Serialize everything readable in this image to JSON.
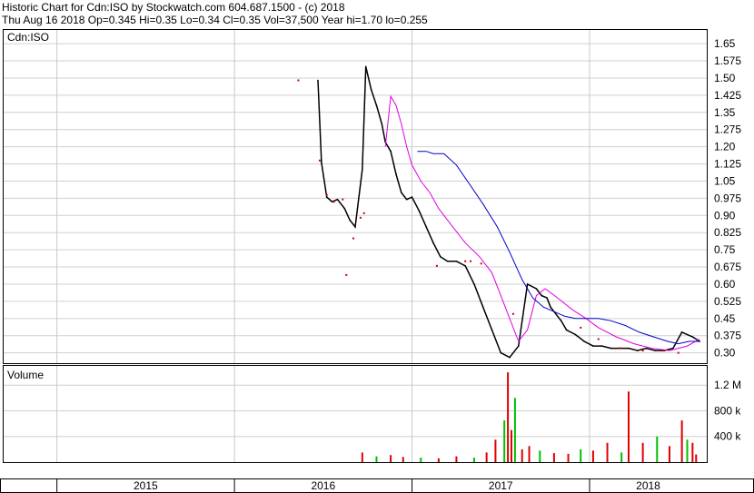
{
  "header": {
    "title": "Historic Chart for Cdn:ISO by Stockwatch.com 604.687.1500 - (c) 2018",
    "quote": "Thu Aug 16 2018   Op=0.345   Hi=0.35   Lo=0.34   Cl=0.35   Vol=37,500   Year hi=1.70   lo=0.255"
  },
  "chart_data": [
    {
      "type": "line",
      "panel_label": "Cdn:ISO",
      "y_ticks": [
        "0.30",
        "0.375",
        "0.45",
        "0.525",
        "0.60",
        "0.675",
        "0.75",
        "0.825",
        "0.90",
        "0.975",
        "1.05",
        "1.125",
        "1.20",
        "1.275",
        "1.35",
        "1.425",
        "1.50",
        "1.575",
        "1.65"
      ],
      "ylim": [
        0.255,
        1.71
      ],
      "grid": true,
      "x_axis_years": [
        "2015",
        "2016",
        "2017",
        "2018"
      ],
      "price_series": {
        "name": "",
        "color": "#000000",
        "x_year": [
          2016.47,
          2016.49,
          2016.52,
          2016.55,
          2016.58,
          2016.62,
          2016.65,
          2016.68,
          2016.72,
          2016.74,
          2016.77,
          2016.8,
          2016.83,
          2016.85,
          2016.88,
          2016.91,
          2016.94,
          2016.97,
          2017.0,
          2017.04,
          2017.08,
          2017.12,
          2017.16,
          2017.2,
          2017.25,
          2017.3,
          2017.35,
          2017.4,
          2017.45,
          2017.5,
          2017.55,
          2017.6,
          2017.65,
          2017.7,
          2017.73,
          2017.76,
          2017.78,
          2017.81,
          2017.84,
          2017.87,
          2017.92,
          2017.97,
          2018.02,
          2018.07,
          2018.12,
          2018.17,
          2018.22,
          2018.27,
          2018.32,
          2018.37,
          2018.42,
          2018.47,
          2018.52,
          2018.55,
          2018.58,
          2018.62
        ],
        "close": [
          1.49,
          1.13,
          0.98,
          0.96,
          0.97,
          0.93,
          0.88,
          0.85,
          1.1,
          1.55,
          1.45,
          1.38,
          1.3,
          1.22,
          1.18,
          1.08,
          1.0,
          0.97,
          0.98,
          0.92,
          0.85,
          0.78,
          0.72,
          0.7,
          0.7,
          0.68,
          0.6,
          0.5,
          0.4,
          0.3,
          0.28,
          0.33,
          0.6,
          0.58,
          0.55,
          0.54,
          0.5,
          0.47,
          0.44,
          0.4,
          0.38,
          0.35,
          0.33,
          0.33,
          0.32,
          0.32,
          0.32,
          0.31,
          0.32,
          0.31,
          0.31,
          0.32,
          0.39,
          0.38,
          0.37,
          0.35
        ]
      },
      "ma_fast": {
        "name": "",
        "color": "#e000e0",
        "x_year": [
          2016.85,
          2016.88,
          2016.91,
          2016.94,
          2016.97,
          2017.0,
          2017.05,
          2017.1,
          2017.15,
          2017.22,
          2017.3,
          2017.38,
          2017.45,
          2017.5,
          2017.56,
          2017.6,
          2017.65,
          2017.7,
          2017.75,
          2017.82,
          2017.9,
          2017.98,
          2018.05,
          2018.15,
          2018.25,
          2018.35,
          2018.45,
          2018.55,
          2018.62
        ],
        "values": [
          1.2,
          1.42,
          1.38,
          1.3,
          1.2,
          1.12,
          1.05,
          1.0,
          0.93,
          0.86,
          0.78,
          0.72,
          0.65,
          0.55,
          0.43,
          0.35,
          0.4,
          0.55,
          0.58,
          0.54,
          0.49,
          0.45,
          0.41,
          0.37,
          0.34,
          0.32,
          0.31,
          0.33,
          0.36
        ]
      },
      "ma_slow": {
        "name": "",
        "color": "#0000c8",
        "x_year": [
          2017.03,
          2017.08,
          2017.12,
          2017.18,
          2017.25,
          2017.33,
          2017.4,
          2017.48,
          2017.55,
          2017.62,
          2017.68,
          2017.74,
          2017.8,
          2017.86,
          2017.92,
          2017.98,
          2018.05,
          2018.12,
          2018.2,
          2018.28,
          2018.36,
          2018.44,
          2018.5,
          2018.56,
          2018.62
        ],
        "values": [
          1.18,
          1.18,
          1.17,
          1.17,
          1.12,
          1.03,
          0.95,
          0.85,
          0.74,
          0.62,
          0.54,
          0.5,
          0.48,
          0.46,
          0.45,
          0.45,
          0.45,
          0.44,
          0.42,
          0.39,
          0.37,
          0.35,
          0.34,
          0.35,
          0.35
        ]
      },
      "trade_dots": {
        "color": "#cc0000",
        "x_year": [
          2016.36,
          2016.48,
          2016.52,
          2016.56,
          2016.61,
          2016.63,
          2016.67,
          2016.71,
          2016.73,
          2017.14,
          2017.3,
          2017.33,
          2017.39,
          2017.57,
          2017.95,
          2018.05,
          2018.17,
          2018.3,
          2018.42,
          2018.5
        ],
        "values": [
          1.49,
          1.14,
          0.99,
          0.96,
          0.97,
          0.64,
          0.8,
          0.89,
          0.91,
          0.68,
          0.7,
          0.7,
          0.69,
          0.47,
          0.41,
          0.36,
          0.32,
          0.31,
          0.31,
          0.3
        ]
      }
    },
    {
      "type": "bar",
      "panel_label": "Volume",
      "y_ticks": [
        "400 k",
        "800 k",
        "1.2 M"
      ],
      "ylim": [
        0,
        1500000
      ],
      "grid": true,
      "x_year": [
        2016.72,
        2016.8,
        2016.88,
        2016.95,
        2017.05,
        2017.15,
        2017.25,
        2017.35,
        2017.42,
        2017.47,
        2017.52,
        2017.54,
        2017.56,
        2017.58,
        2017.62,
        2017.66,
        2017.72,
        2017.8,
        2017.88,
        2017.95,
        2018.02,
        2018.1,
        2018.18,
        2018.22,
        2018.3,
        2018.38,
        2018.45,
        2018.52,
        2018.55,
        2018.58,
        2018.6
      ],
      "values": [
        150000,
        90000,
        110000,
        80000,
        70000,
        60000,
        90000,
        70000,
        150000,
        350000,
        650000,
        1400000,
        500000,
        1000000,
        200000,
        250000,
        180000,
        140000,
        130000,
        200000,
        180000,
        300000,
        150000,
        1100000,
        300000,
        400000,
        250000,
        650000,
        350000,
        300000,
        120000
      ],
      "up_color": "#00c000",
      "down_color": "#e00000"
    }
  ]
}
